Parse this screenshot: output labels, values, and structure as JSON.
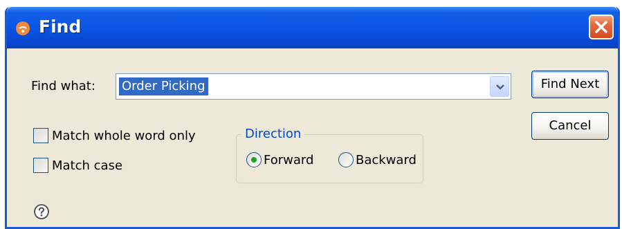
{
  "window": {
    "title": "Find",
    "close_label": "Close"
  },
  "find": {
    "label": "Find what:",
    "value": "Order Picking"
  },
  "buttons": {
    "find_next": "Find Next",
    "cancel": "Cancel"
  },
  "options": {
    "match_whole_word": {
      "label": "Match whole word only",
      "checked": false
    },
    "match_case": {
      "label": "Match case",
      "checked": false
    }
  },
  "direction": {
    "title": "Direction",
    "forward": {
      "label": "Forward",
      "selected": true
    },
    "backward": {
      "label": "Backward",
      "selected": false
    }
  },
  "icons": {
    "app": "app-icon",
    "close": "close-icon",
    "dropdown": "chevron-down-icon",
    "help": "help-icon"
  },
  "colors": {
    "titlebar": "#0a55e4",
    "close_button": "#d44b1e",
    "selection": "#316ac5",
    "group_title": "#0046d5",
    "radio_dot": "#21a121",
    "dialog_bg": "#ece9d8"
  }
}
